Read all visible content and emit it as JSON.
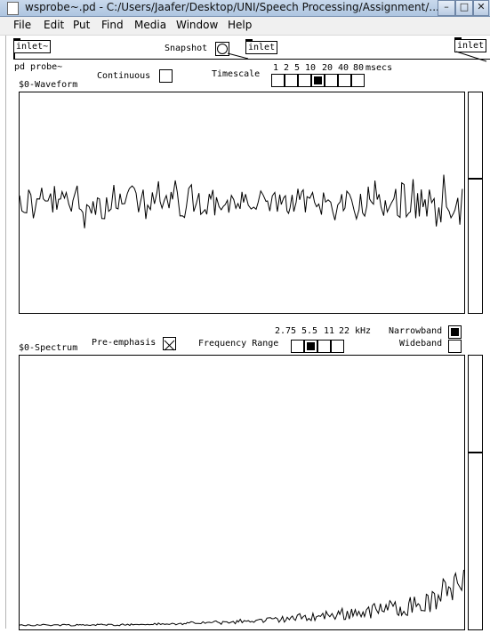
{
  "window": {
    "title": "wsprobe~.pd  - C:/Users/Jaafer/Desktop/UNI/Speech Processing/Assignment/...",
    "min_glyph": "–",
    "max_glyph": "□",
    "close_glyph": "✕"
  },
  "menu": [
    "File",
    "Edit",
    "Put",
    "Find",
    "Media",
    "Window",
    "Help"
  ],
  "patch": {
    "inlet_signal": "inlet~",
    "snapshot_label": "Snapshot",
    "inlet_snapshot": "inlet",
    "inlet_right": "inlet",
    "subpatch_title": "pd probe~",
    "waveform_label": "$0-Waveform",
    "continuous_label": "Continuous",
    "continuous_on": false,
    "timescale_label": "Timescale",
    "timescale_options": [
      "1",
      "2",
      "5",
      "10",
      "20",
      "40",
      "80"
    ],
    "timescale_unit": "msecs",
    "timescale_selected_index": 3,
    "freq_options": [
      "2.75",
      "5.5",
      "11",
      "22"
    ],
    "freq_unit": "kHz",
    "freq_range_label": "Frequency Range",
    "freq_selected_index": 1,
    "spectrum_label": "$0-Spectrum",
    "preemphasis_label": "Pre-emphasis",
    "preemphasis_on": true,
    "narrowband_label": "Narrowband",
    "wideband_label": "Wideband",
    "band_selected": "Narrowband"
  }
}
